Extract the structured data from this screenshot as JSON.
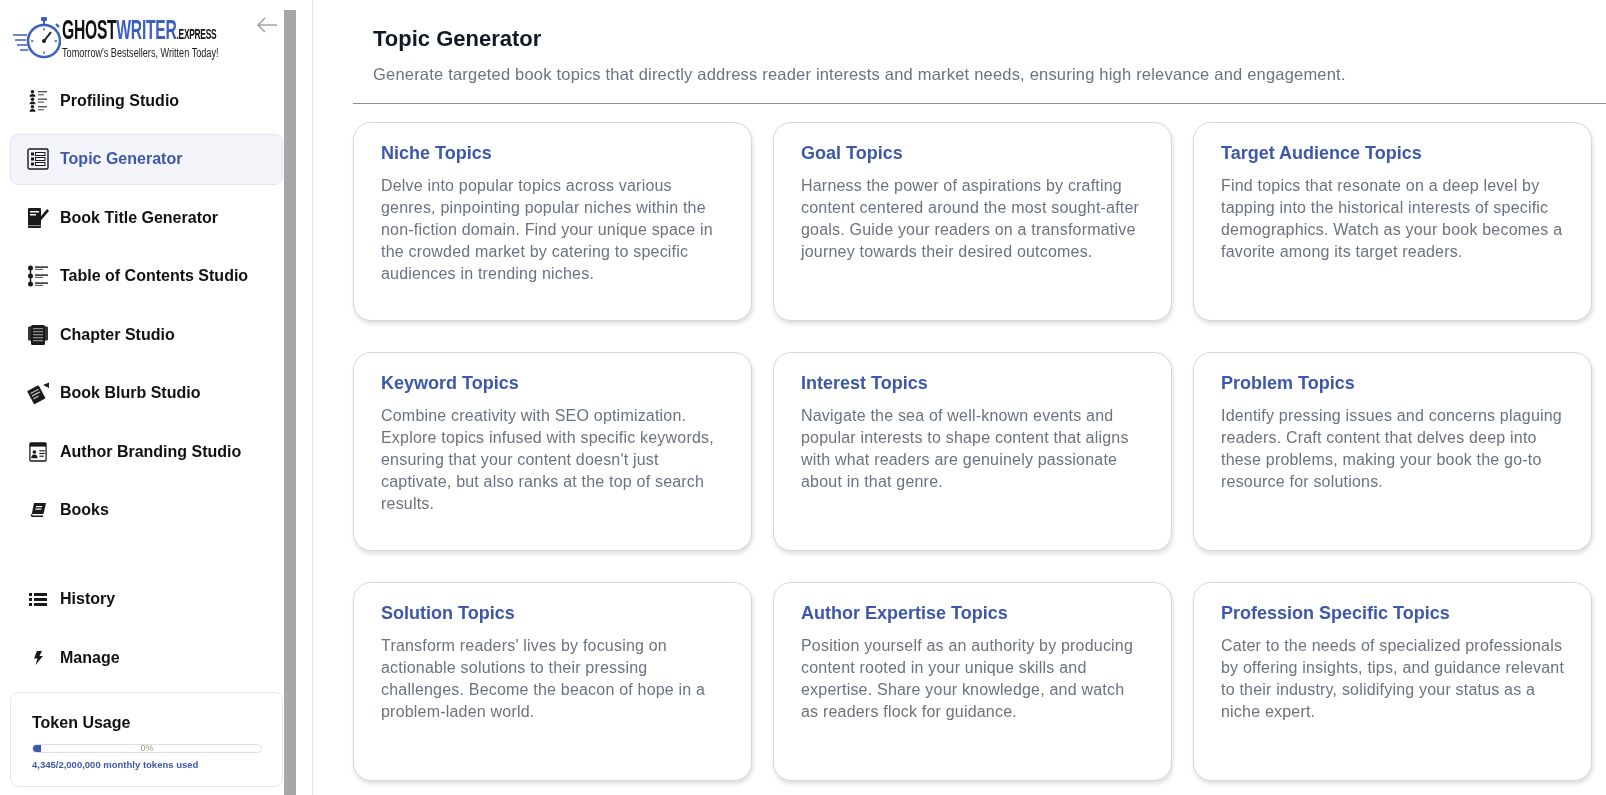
{
  "sidebar": {
    "logo": {
      "wordmark": [
        {
          "text": "GHOST",
          "kind": "dark"
        },
        {
          "text": "WRITER",
          "kind": "accent"
        },
        {
          "text": ".EXPRESS",
          "kind": "suffix"
        }
      ],
      "tagline": "Tomorrow's Bestsellers, Written Today!"
    },
    "nav_items": [
      {
        "label": "Profiling Studio",
        "selected": false
      },
      {
        "label": "Topic Generator",
        "selected": true
      },
      {
        "label": "Book Title Generator",
        "selected": false
      },
      {
        "label": "Table of Contents Studio",
        "selected": false
      },
      {
        "label": "Chapter Studio",
        "selected": false
      },
      {
        "label": "Book Blurb Studio",
        "selected": false
      },
      {
        "label": "Author Branding Studio",
        "selected": false
      },
      {
        "label": "Books",
        "selected": false
      }
    ],
    "bottom_items": [
      {
        "label": "History",
        "selected": false
      },
      {
        "label": "Manage",
        "selected": false
      }
    ],
    "token_usage": {
      "title": "Token Usage",
      "level": 0.002,
      "percent_label": "0%",
      "caption": "4,345/2,000,000 monthly tokens used"
    }
  },
  "header": {
    "title": "Topic Generator",
    "subtitle": "Generate targeted book topics that directly address reader interests and market needs, ensuring high relevance and engagement."
  },
  "cards": [
    {
      "title": "Niche Topics",
      "description": "Delve into popular topics across various genres, pinpointing popular niches within the non-fiction domain. Find your unique space in the crowded market by catering to specific audiences in trending niches."
    },
    {
      "title": "Goal Topics",
      "description": "Harness the power of aspirations by crafting content centered around the most sought-after goals. Guide your readers on a transformative journey towards their desired outcomes."
    },
    {
      "title": "Target Audience Topics",
      "description": "Find topics that resonate on a deep level by tapping into the historical interests of specific demographics. Watch as your book becomes a favorite among its target readers."
    },
    {
      "title": "Keyword Topics",
      "description": "Combine creativity with SEO optimization. Explore topics infused with specific keywords, ensuring that your content doesn't just captivate, but also ranks at the top of search results."
    },
    {
      "title": "Interest Topics",
      "description": "Navigate the sea of well-known events and popular interests to shape content that aligns with what readers are genuinely passionate about in that genre."
    },
    {
      "title": "Problem Topics",
      "description": "Identify pressing issues and concerns plaguing readers. Craft content that delves deep into these problems, making your book the go-to resource for solutions."
    },
    {
      "title": "Solution Topics",
      "description": "Transform readers' lives by focusing on actionable solutions to their pressing challenges. Become the beacon of hope in a problem-laden world."
    },
    {
      "title": "Author Expertise Topics",
      "description": "Position yourself as an authority by producing content rooted in your unique skills and expertise. Share your knowledge, and watch as readers flock for guidance."
    },
    {
      "title": "Profession Specific Topics",
      "description": "Cater to the needs of specialized professionals by offering insights, tips, and guidance relevant to their industry, solidifying your status as a niche expert."
    }
  ]
}
